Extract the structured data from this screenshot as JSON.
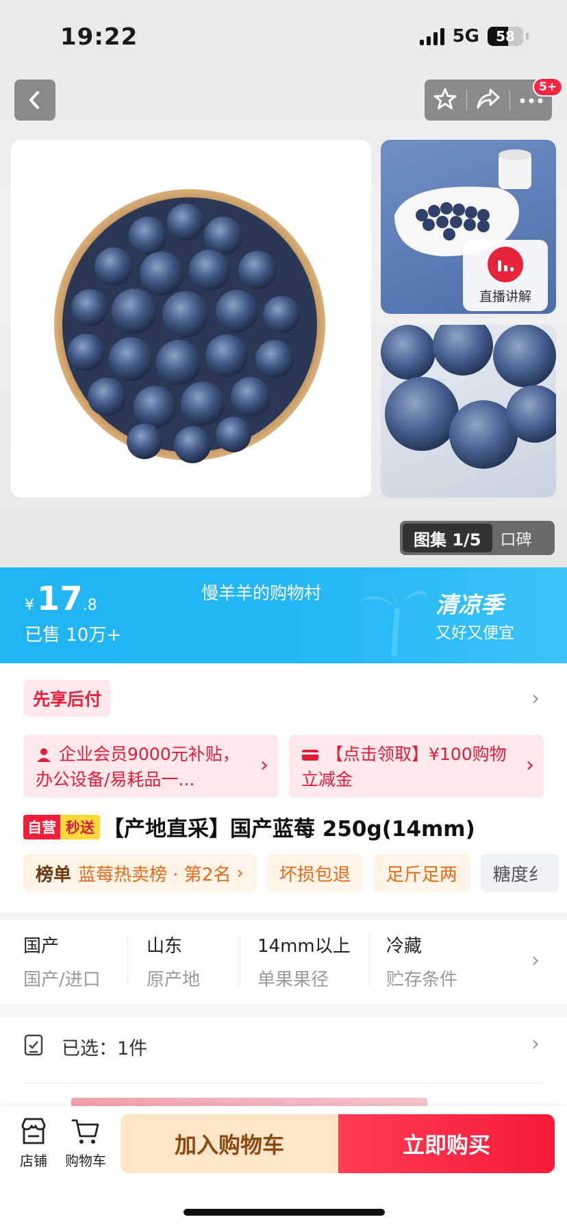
{
  "status_bar": {
    "time": "19:22",
    "network": "5G",
    "battery": "58"
  },
  "nav": {
    "more_badge": "5+",
    "icons": {
      "back": "back-arrow-icon",
      "favorite": "star-icon",
      "share": "share-icon",
      "more": "more-dots-icon"
    }
  },
  "gallery": {
    "live_label": "直播讲解",
    "pill_active": "图集 1/5",
    "pill_inactive": "口碑"
  },
  "price_banner": {
    "currency": "¥",
    "price_int": "17",
    "price_dec": ".8",
    "sold": "已售 10万+",
    "shop_name": "慢羊羊的购物村",
    "season_title": "清凉季",
    "season_sub": "又好又便宜",
    "colors": {
      "banner": "#26b8f6"
    }
  },
  "pay_later": "先享后付",
  "promos": [
    {
      "text": "企业会员9000元补贴，办公设备/易耗品一...",
      "icon": "user-icon"
    },
    {
      "text": "【点击领取】¥100购物立减金",
      "icon": "card-icon"
    }
  ],
  "product": {
    "tag_self": "自营",
    "tag_fast": "秒送",
    "title": "【产地直采】国产蓝莓 250g(14mm)"
  },
  "chips": {
    "rank_label": "榜单",
    "rank_text": "蓝莓热卖榜 · 第2名",
    "items": [
      "坏损包退",
      "足斤足两",
      "糖度纟"
    ]
  },
  "specs": [
    {
      "value": "国产",
      "key": "国产/进口"
    },
    {
      "value": "山东",
      "key": "原产地"
    },
    {
      "value": "14mm以上",
      "key": "单果果径"
    },
    {
      "value": "冷藏",
      "key": "贮存条件"
    }
  ],
  "selected": "已选：1件",
  "bottom_bar": {
    "store_label": "店铺",
    "cart_label": "购物车",
    "add_to_cart": "加入购物车",
    "buy_now": "立即购买"
  }
}
